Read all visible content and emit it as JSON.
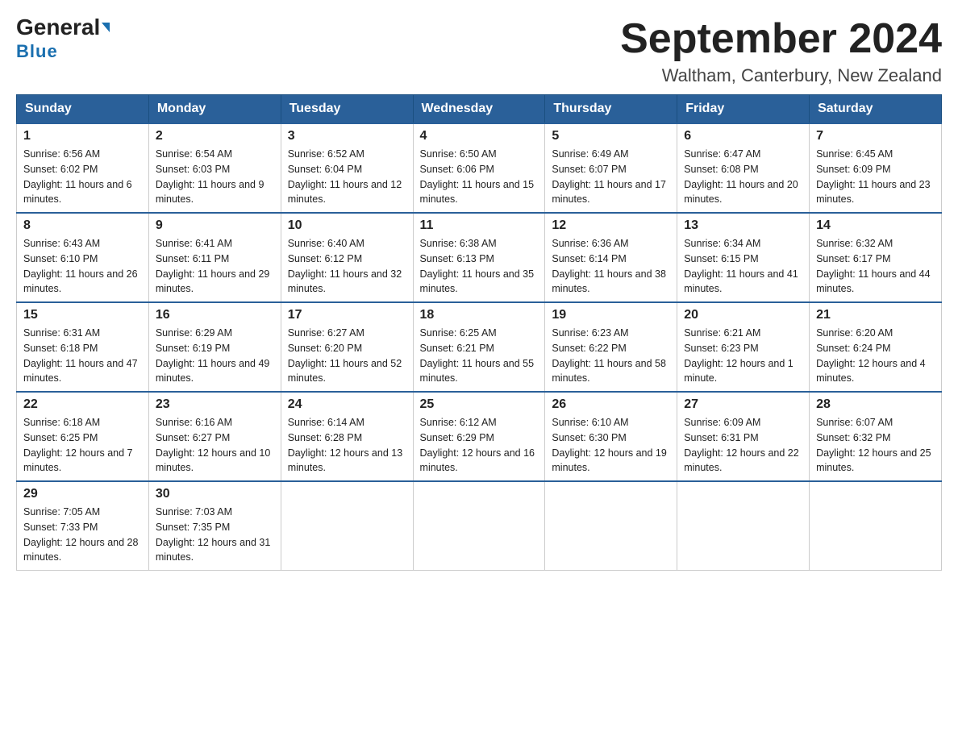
{
  "header": {
    "logo_general": "General",
    "logo_blue": "Blue",
    "title": "September 2024",
    "subtitle": "Waltham, Canterbury, New Zealand"
  },
  "days_of_week": [
    "Sunday",
    "Monday",
    "Tuesday",
    "Wednesday",
    "Thursday",
    "Friday",
    "Saturday"
  ],
  "weeks": [
    [
      {
        "day": "1",
        "sunrise": "6:56 AM",
        "sunset": "6:02 PM",
        "daylight": "11 hours and 6 minutes."
      },
      {
        "day": "2",
        "sunrise": "6:54 AM",
        "sunset": "6:03 PM",
        "daylight": "11 hours and 9 minutes."
      },
      {
        "day": "3",
        "sunrise": "6:52 AM",
        "sunset": "6:04 PM",
        "daylight": "11 hours and 12 minutes."
      },
      {
        "day": "4",
        "sunrise": "6:50 AM",
        "sunset": "6:06 PM",
        "daylight": "11 hours and 15 minutes."
      },
      {
        "day": "5",
        "sunrise": "6:49 AM",
        "sunset": "6:07 PM",
        "daylight": "11 hours and 17 minutes."
      },
      {
        "day": "6",
        "sunrise": "6:47 AM",
        "sunset": "6:08 PM",
        "daylight": "11 hours and 20 minutes."
      },
      {
        "day": "7",
        "sunrise": "6:45 AM",
        "sunset": "6:09 PM",
        "daylight": "11 hours and 23 minutes."
      }
    ],
    [
      {
        "day": "8",
        "sunrise": "6:43 AM",
        "sunset": "6:10 PM",
        "daylight": "11 hours and 26 minutes."
      },
      {
        "day": "9",
        "sunrise": "6:41 AM",
        "sunset": "6:11 PM",
        "daylight": "11 hours and 29 minutes."
      },
      {
        "day": "10",
        "sunrise": "6:40 AM",
        "sunset": "6:12 PM",
        "daylight": "11 hours and 32 minutes."
      },
      {
        "day": "11",
        "sunrise": "6:38 AM",
        "sunset": "6:13 PM",
        "daylight": "11 hours and 35 minutes."
      },
      {
        "day": "12",
        "sunrise": "6:36 AM",
        "sunset": "6:14 PM",
        "daylight": "11 hours and 38 minutes."
      },
      {
        "day": "13",
        "sunrise": "6:34 AM",
        "sunset": "6:15 PM",
        "daylight": "11 hours and 41 minutes."
      },
      {
        "day": "14",
        "sunrise": "6:32 AM",
        "sunset": "6:17 PM",
        "daylight": "11 hours and 44 minutes."
      }
    ],
    [
      {
        "day": "15",
        "sunrise": "6:31 AM",
        "sunset": "6:18 PM",
        "daylight": "11 hours and 47 minutes."
      },
      {
        "day": "16",
        "sunrise": "6:29 AM",
        "sunset": "6:19 PM",
        "daylight": "11 hours and 49 minutes."
      },
      {
        "day": "17",
        "sunrise": "6:27 AM",
        "sunset": "6:20 PM",
        "daylight": "11 hours and 52 minutes."
      },
      {
        "day": "18",
        "sunrise": "6:25 AM",
        "sunset": "6:21 PM",
        "daylight": "11 hours and 55 minutes."
      },
      {
        "day": "19",
        "sunrise": "6:23 AM",
        "sunset": "6:22 PM",
        "daylight": "11 hours and 58 minutes."
      },
      {
        "day": "20",
        "sunrise": "6:21 AM",
        "sunset": "6:23 PM",
        "daylight": "12 hours and 1 minute."
      },
      {
        "day": "21",
        "sunrise": "6:20 AM",
        "sunset": "6:24 PM",
        "daylight": "12 hours and 4 minutes."
      }
    ],
    [
      {
        "day": "22",
        "sunrise": "6:18 AM",
        "sunset": "6:25 PM",
        "daylight": "12 hours and 7 minutes."
      },
      {
        "day": "23",
        "sunrise": "6:16 AM",
        "sunset": "6:27 PM",
        "daylight": "12 hours and 10 minutes."
      },
      {
        "day": "24",
        "sunrise": "6:14 AM",
        "sunset": "6:28 PM",
        "daylight": "12 hours and 13 minutes."
      },
      {
        "day": "25",
        "sunrise": "6:12 AM",
        "sunset": "6:29 PM",
        "daylight": "12 hours and 16 minutes."
      },
      {
        "day": "26",
        "sunrise": "6:10 AM",
        "sunset": "6:30 PM",
        "daylight": "12 hours and 19 minutes."
      },
      {
        "day": "27",
        "sunrise": "6:09 AM",
        "sunset": "6:31 PM",
        "daylight": "12 hours and 22 minutes."
      },
      {
        "day": "28",
        "sunrise": "6:07 AM",
        "sunset": "6:32 PM",
        "daylight": "12 hours and 25 minutes."
      }
    ],
    [
      {
        "day": "29",
        "sunrise": "7:05 AM",
        "sunset": "7:33 PM",
        "daylight": "12 hours and 28 minutes."
      },
      {
        "day": "30",
        "sunrise": "7:03 AM",
        "sunset": "7:35 PM",
        "daylight": "12 hours and 31 minutes."
      },
      null,
      null,
      null,
      null,
      null
    ]
  ]
}
